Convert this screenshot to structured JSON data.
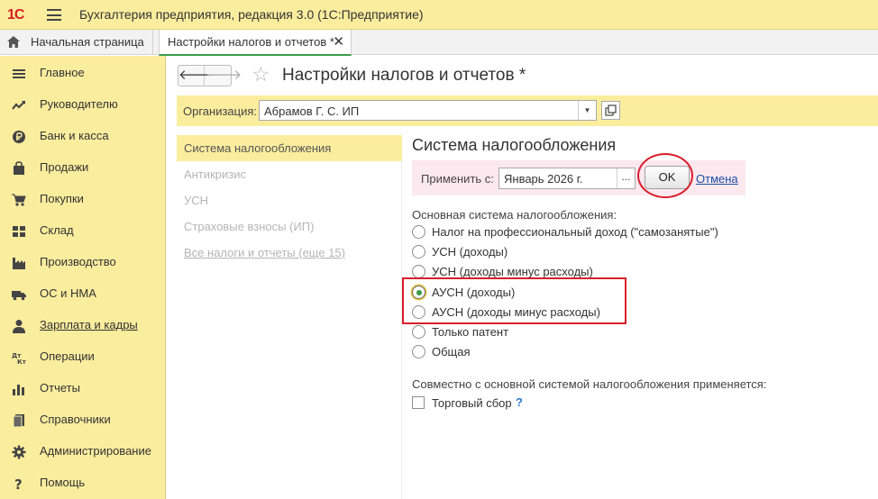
{
  "app": {
    "logo": "1С",
    "title": "Бухгалтерия предприятия, редакция 3.0  (1С:Предприятие)"
  },
  "tabs": {
    "home_label": "Начальная страница",
    "active_label": "Настройки налогов и отчетов *",
    "close_glyph": "✕"
  },
  "sidebar": {
    "items": [
      {
        "label": "Главное",
        "icon": "menu-lines-icon"
      },
      {
        "label": "Руководителю",
        "icon": "trend-icon"
      },
      {
        "label": "Банк и касса",
        "icon": "ruble-coin-icon"
      },
      {
        "label": "Продажи",
        "icon": "shopping-bag-icon"
      },
      {
        "label": "Покупки",
        "icon": "cart-icon"
      },
      {
        "label": "Склад",
        "icon": "warehouse-icon"
      },
      {
        "label": "Производство",
        "icon": "factory-icon"
      },
      {
        "label": "ОС и НМА",
        "icon": "truck-icon"
      },
      {
        "label": "Зарплата и кадры",
        "icon": "person-icon"
      },
      {
        "label": "Операции",
        "icon": "dt-kt-icon"
      },
      {
        "label": "Отчеты",
        "icon": "bar-chart-icon"
      },
      {
        "label": "Справочники",
        "icon": "books-icon"
      },
      {
        "label": "Администрирование",
        "icon": "gear-icon"
      },
      {
        "label": "Помощь",
        "icon": "help-icon"
      }
    ]
  },
  "form": {
    "back_glyph": "🡐",
    "forward_glyph": "🡒",
    "star_glyph": "☆",
    "title": "Настройки налогов и отчетов *",
    "org_label": "Организация:",
    "org_value": "Абрамов Г. С. ИП",
    "dropdown_glyph": "▼"
  },
  "sections": [
    {
      "label": "Система налогообложения"
    },
    {
      "label": "Антикризис"
    },
    {
      "label": "УСН"
    },
    {
      "label": "Страховые взносы (ИП)"
    },
    {
      "label": "Все налоги и отчеты (еще 15)"
    }
  ],
  "tax_system": {
    "title": "Система налогообложения",
    "apply_label": "Применить с:",
    "apply_value": "Январь 2026 г.",
    "dots_glyph": "...",
    "ok_label": "OK",
    "cancel_label": "Отмена",
    "group_label": "Основная система налогообложения:",
    "options": [
      {
        "label": "Налог на профессиональный доход (\"самозанятые\")"
      },
      {
        "label": "УСН (доходы)"
      },
      {
        "label": "УСН (доходы минус расходы)"
      },
      {
        "label": "АУСН (доходы)"
      },
      {
        "label": "АУСН (доходы минус расходы)"
      },
      {
        "label": "Только патент"
      },
      {
        "label": "Общая"
      }
    ],
    "selected_option": "АУСН (доходы)",
    "group2_label": "Совместно с основной системой налогообложения применяется:",
    "trade_fee_label": "Торговый сбор",
    "help_glyph": "?"
  },
  "colors": {
    "accent_yellow": "#fbed9e",
    "highlight_red": "#d81e2c",
    "link_blue": "#1a4fa3",
    "tab_green": "#3b9b4a"
  }
}
